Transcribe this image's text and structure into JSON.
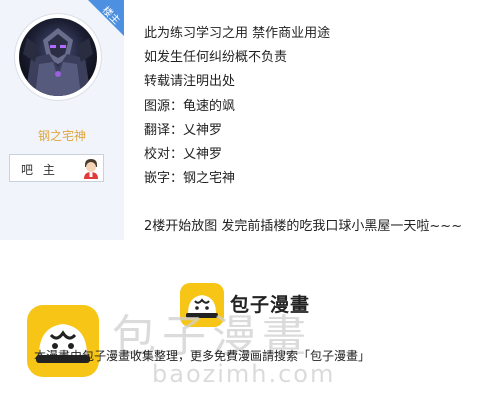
{
  "sidebar": {
    "badge": "楼主",
    "username": "钢之宅神",
    "role_label": "吧 主"
  },
  "post": {
    "lines": [
      "此为练习学习之用 禁作商业用途",
      "如发生任何纠纷概不负责",
      "转载请注明出处",
      "图源：龟速的飒",
      "翻译：乂神罗",
      "校对：乂神罗",
      "嵌字：钢之宅神"
    ],
    "footer": "2楼开始放图 发完前插楼的吃我口球小黑屋一天啦~~~"
  },
  "watermark": {
    "brand": "包子漫畫",
    "big_text": "包子漫畫",
    "url": "baozimh.com",
    "caption": "本漫畫由包子漫畫收集整理，更多免費漫画請搜索「包子漫畫」",
    "brand_color": "#f7c515"
  }
}
